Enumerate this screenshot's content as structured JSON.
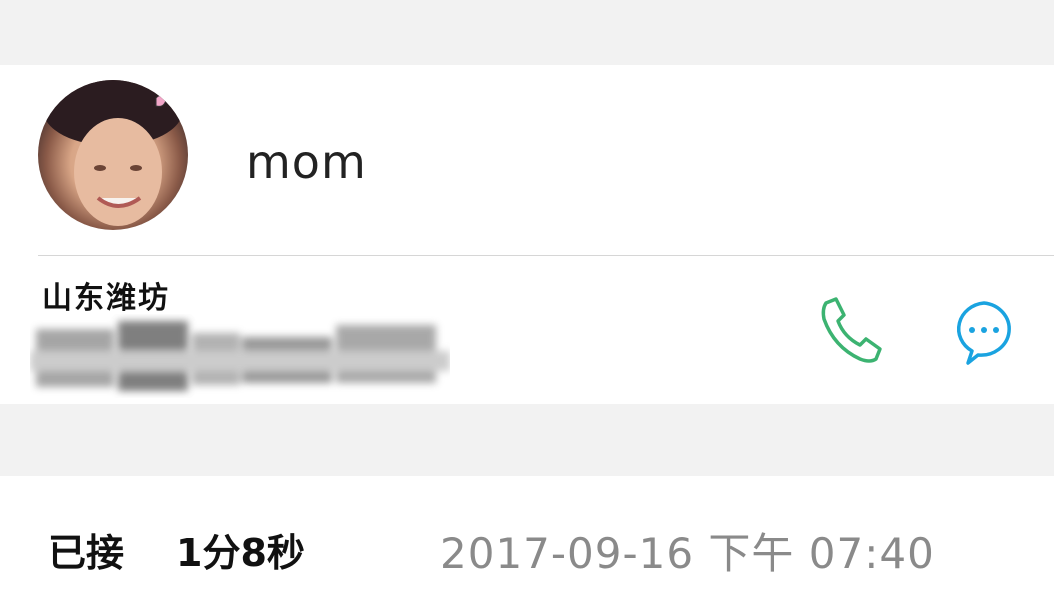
{
  "contact": {
    "name": "mom",
    "location": "山东潍坊"
  },
  "actions": {
    "call_icon": "phone-icon",
    "message_icon": "chat-bubble-icon",
    "call_color": "#3cb371",
    "message_color": "#1aa3e0"
  },
  "call_record": {
    "status": "已接",
    "duration": "1分8秒",
    "timestamp": "2017-09-16 下午 07:40"
  }
}
